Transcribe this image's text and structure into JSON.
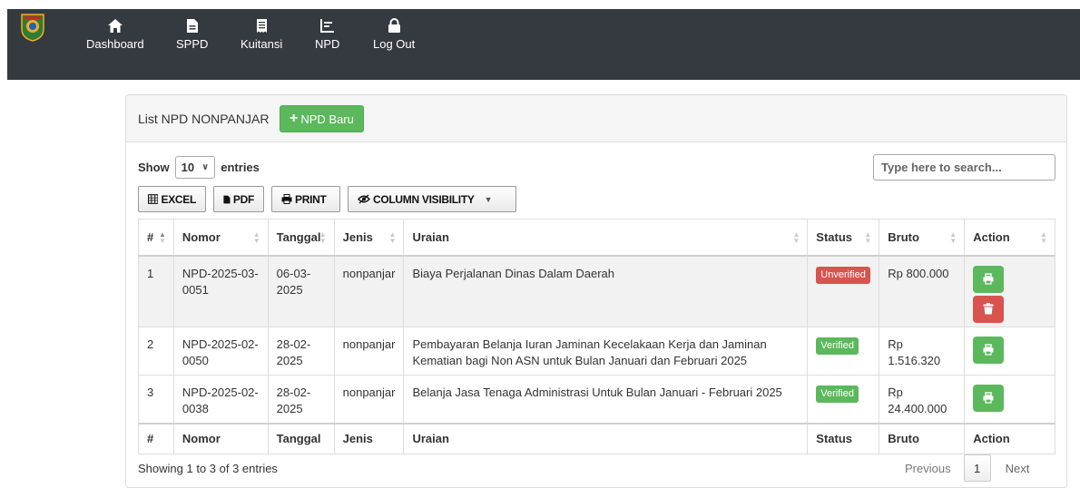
{
  "nav": {
    "items": [
      {
        "label": "Dashboard",
        "icon": "home-icon"
      },
      {
        "label": "SPPD",
        "icon": "file-icon"
      },
      {
        "label": "Kuitansi",
        "icon": "receipt-icon"
      },
      {
        "label": "NPD",
        "icon": "chart-icon"
      },
      {
        "label": "Log Out",
        "icon": "lock-icon"
      }
    ]
  },
  "panel": {
    "title": "List NPD NONPANJAR",
    "new_button": "NPD Baru"
  },
  "controls": {
    "show_label": "Show",
    "entries_value": "10",
    "entries_label": "entries",
    "search_placeholder": "Type here to search...",
    "buttons": {
      "excel": "EXCEL",
      "pdf": "PDF",
      "print": "PRINT",
      "colvis": "COLUMN VISIBILITY"
    }
  },
  "table": {
    "headers": [
      "#",
      "Nomor",
      "Tanggal",
      "Jenis",
      "Uraian",
      "Status",
      "Bruto",
      "Action"
    ],
    "rows": [
      {
        "no": "1",
        "nomor": "NPD-2025-03-0051",
        "tanggal": "06-03-2025",
        "jenis": "nonpanjar",
        "uraian": "Biaya Perjalanan Dinas Dalam Daerah",
        "status": "Unverified",
        "bruto": "Rp 800.000"
      },
      {
        "no": "2",
        "nomor": "NPD-2025-02-0050",
        "tanggal": "28-02-2025",
        "jenis": "nonpanjar",
        "uraian": "Pembayaran Belanja Iuran Jaminan Kecelakaan Kerja dan Jaminan Kematian bagi Non ASN untuk Bulan Januari dan Februari 2025",
        "status": "Verified",
        "bruto": "Rp 1.516.320"
      },
      {
        "no": "3",
        "nomor": "NPD-2025-02-0038",
        "tanggal": "28-02-2025",
        "jenis": "nonpanjar",
        "uraian": "Belanja Jasa Tenaga Administrasi Untuk Bulan Januari - Februari 2025",
        "status": "Verified",
        "bruto": "Rp 24.400.000"
      }
    ]
  },
  "footer": {
    "info": "Showing 1 to 3 of 3 entries",
    "previous": "Previous",
    "page": "1",
    "next": "Next"
  },
  "colors": {
    "navbar": "#343a40",
    "success": "#5cb85c",
    "danger": "#d9534f"
  }
}
